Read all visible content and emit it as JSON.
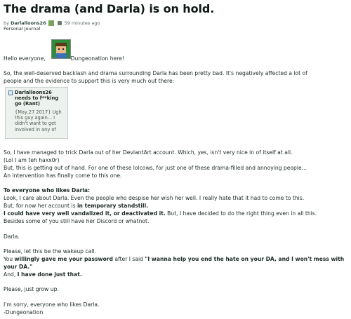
{
  "post": {
    "title": "The drama (and Darla) is on hold.",
    "byline": {
      "prefix": "by",
      "author": "Darlalloons26",
      "time": "59 minutes ago",
      "journal_type": "Personal Journal"
    }
  },
  "body": {
    "greeting_before": "Hello everyone,",
    "greeting_after": "Dungeonation here!",
    "p1_line1": "So, the well-deserved backlash and drama surrounding Darla has been pretty bad. It's negatively affected a lot of",
    "p1_line2": "people and the evidence to support this is very much out there:",
    "card": {
      "title": "Darlalloons26 needs to f**king go (Rant)",
      "body": "{May,27 2017} Ugh this guy again... I didn't want to get involved in any of"
    },
    "p2_line1": "So, I have managed to trick Darla out of her DeviantArt account. Which, yes, isn't very nice in of itself at all.",
    "p2_line2": "(Lol I am teh haxx0r)",
    "p2_line3": "But, this is getting out of hand. For one of these lolcows, for just one of these drama-filled and annoying people...",
    "p2_line4": "An intervention has finally come to this one.",
    "p3_heading": "To everyone who likes Darla:",
    "p3_line1": "Look, I care about Darla. Even the people who despise her wish her well. I really hate that it had to come to this.",
    "p3_line2_a": "But, for now her account is ",
    "p3_line2_b": "in temporary standstill.",
    "p3_line3_a": "I could have very well vandalized it, or deactivated it.",
    "p3_line3_b": " But, I have decided to do the right thing even in all this.",
    "p3_line4": "Besides some of you still have her Discord or whatnot.",
    "p4": "Darla.",
    "p5_line1": "Please, let this be the wakeup call.",
    "p5_line2_a": "You ",
    "p5_line2_b": "willingly gave me your password",
    "p5_line2_c": " after I said ",
    "p5_line2_d": "\"I wanna help you end the hate on your DA, and I won't mess with",
    "p5_line3_a": "your DA.\"",
    "p5_line4_a": "And, ",
    "p5_line4_b": "I have done just that.",
    "p6": "Please, just grow up.",
    "p7_line1": "I'm sorry, everyone who likes Darla.",
    "p7_line2": "-Dungeonation"
  }
}
